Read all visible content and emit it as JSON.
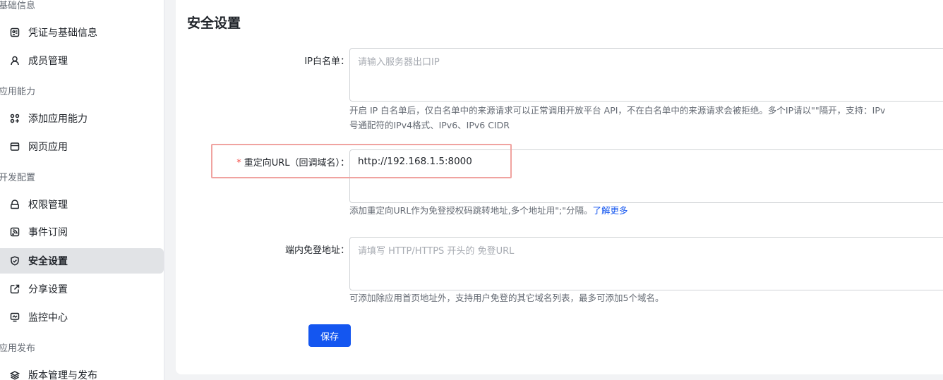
{
  "sidebar": {
    "groups": [
      {
        "title": "基础信息"
      },
      {
        "title": "应用能力"
      },
      {
        "title": "开发配置"
      },
      {
        "title": "应用发布"
      }
    ],
    "items": [
      {
        "label": "凭证与基础信息",
        "icon": "credential-icon"
      },
      {
        "label": "成员管理",
        "icon": "member-icon"
      },
      {
        "label": "添加应用能力",
        "icon": "apps-icon"
      },
      {
        "label": "网页应用",
        "icon": "webpage-icon"
      },
      {
        "label": "权限管理",
        "icon": "lock-icon"
      },
      {
        "label": "事件订阅",
        "icon": "subscription-icon"
      },
      {
        "label": "安全设置",
        "icon": "shield-icon",
        "active": true
      },
      {
        "label": "分享设置",
        "icon": "share-icon"
      },
      {
        "label": "监控中心",
        "icon": "monitor-icon"
      },
      {
        "label": "版本管理与发布",
        "icon": "layers-icon"
      }
    ]
  },
  "main": {
    "title": "安全设置",
    "ip_whitelist": {
      "label": "IP白名单：",
      "placeholder": "请输入服务器出口IP",
      "help_line1": "开启 IP 白名单后，仅白名单中的来源请求可以正常调用开放平台 API，不在白名单中的来源请求会被拒绝。多个IP请以\"\"隔开，支持：IPv",
      "help_line2": "号通配符的IPv4格式、IPv6、IPv6 CIDR"
    },
    "redirect_url": {
      "required_mark": "*",
      "label": "重定向URL（回调域名）：",
      "value": "http://192.168.1.5:8000",
      "help": "添加重定向URL作为免登授权码跳转地址,多个地址用\";\"分隔。",
      "help_link": "了解更多"
    },
    "in_app_login": {
      "label": "端内免登地址：",
      "placeholder": "请填写 HTTP/HTTPS 开头的 免登URL",
      "help": "可添加除应用首页地址外，支持用户免登的其它域名列表，最多可添加5个域名。"
    },
    "save_label": "保存"
  },
  "colors": {
    "primary": "#1456f0",
    "required": "#f54a45",
    "highlight_border": "#f0a3a0",
    "active_item_bg": "#e1e3e6"
  }
}
